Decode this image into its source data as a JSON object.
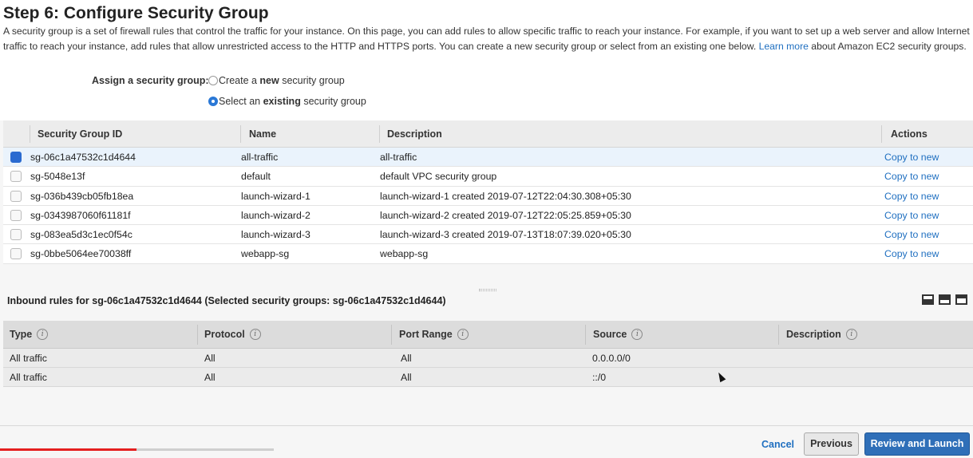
{
  "page": {
    "title": "Step 6: Configure Security Group",
    "intro_text": "A security group is a set of firewall rules that control the traffic for your instance. On this page, you can add rules to allow specific traffic to reach your instance. For example, if you want to set up a web server and allow Internet traffic to reach your instance, add rules that allow unrestricted access to the HTTP and HTTPS ports. You can create a new security group or select from an existing one below. ",
    "learn_more": "Learn more",
    "intro_tail": " about Amazon EC2 security groups."
  },
  "assign": {
    "label": "Assign a security group:",
    "option_new_prefix": "Create a ",
    "option_new_bold": "new",
    "option_new_suffix": " security group",
    "option_existing_prefix": "Select an ",
    "option_existing_bold": "existing",
    "option_existing_suffix": " security group",
    "selected": "existing"
  },
  "security_groups": {
    "columns": [
      "Security Group ID",
      "Name",
      "Description",
      "Actions"
    ],
    "rows": [
      {
        "id": "sg-06c1a47532c1d4644",
        "name": "all-traffic",
        "description": "all-traffic",
        "action": "Copy to new",
        "selected": true
      },
      {
        "id": "sg-5048e13f",
        "name": "default",
        "description": "default VPC security group",
        "action": "Copy to new",
        "selected": false
      },
      {
        "id": "sg-036b439cb05fb18ea",
        "name": "launch-wizard-1",
        "description": "launch-wizard-1 created 2019-07-12T22:04:30.308+05:30",
        "action": "Copy to new",
        "selected": false
      },
      {
        "id": "sg-0343987060f61181f",
        "name": "launch-wizard-2",
        "description": "launch-wizard-2 created 2019-07-12T22:05:25.859+05:30",
        "action": "Copy to new",
        "selected": false
      },
      {
        "id": "sg-083ea5d3c1ec0f54c",
        "name": "launch-wizard-3",
        "description": "launch-wizard-3 created 2019-07-13T18:07:39.020+05:30",
        "action": "Copy to new",
        "selected": false
      },
      {
        "id": "sg-0bbe5064ee70038ff",
        "name": "webapp-sg",
        "description": "webapp-sg",
        "action": "Copy to new",
        "selected": false
      }
    ]
  },
  "inbound": {
    "title": "Inbound rules for sg-06c1a47532c1d4644 (Selected security groups: sg-06c1a47532c1d4644)",
    "columns": [
      "Type",
      "Protocol",
      "Port Range",
      "Source",
      "Description"
    ],
    "rows": [
      {
        "type": "All traffic",
        "protocol": "All",
        "port_range": "All",
        "source": "0.0.0.0/0",
        "description": ""
      },
      {
        "type": "All traffic",
        "protocol": "All",
        "port_range": "All",
        "source": "::/0",
        "description": ""
      }
    ]
  },
  "footer": {
    "cancel": "Cancel",
    "previous": "Previous",
    "review": "Review and Launch"
  },
  "video": {
    "progress_played_fraction": 0.14,
    "progress_loaded_fraction": 0.28
  },
  "colors": {
    "accent": "#2f6fb8",
    "link": "#1f6fc0",
    "progress": "#e41f1f"
  }
}
